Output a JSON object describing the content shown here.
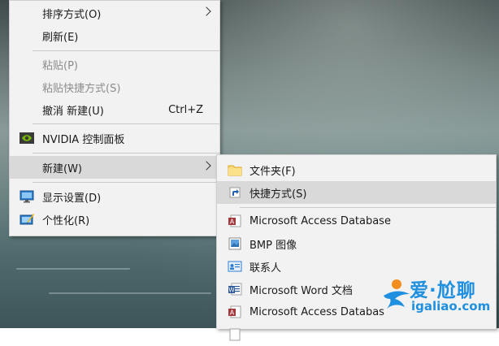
{
  "context_menu": {
    "items": [
      {
        "label": "排序方式(O)"
      },
      {
        "label": "刷新(E)"
      },
      {
        "label": "粘贴(P)"
      },
      {
        "label": "粘贴快捷方式(S)"
      },
      {
        "label": "撤消 新建(U)",
        "accel": "Ctrl+Z"
      },
      {
        "label": "NVIDIA 控制面板",
        "icon": "nvidia-icon"
      },
      {
        "label": "新建(W)"
      },
      {
        "label": "显示设置(D)",
        "icon": "display-settings-icon"
      },
      {
        "label": "个性化(R)",
        "icon": "personalize-icon"
      }
    ]
  },
  "new_submenu": {
    "items": [
      {
        "label": "文件夹(F)",
        "icon": "folder-icon"
      },
      {
        "label": "快捷方式(S)",
        "icon": "shortcut-icon"
      },
      {
        "label": "Microsoft Access Database",
        "icon": "access-icon"
      },
      {
        "label": "BMP 图像",
        "icon": "bmp-image-icon"
      },
      {
        "label": "联系人",
        "icon": "contact-icon"
      },
      {
        "label": "Microsoft Word 文档",
        "icon": "word-icon"
      },
      {
        "label": "Microsoft Access Databas",
        "icon": "access-icon"
      }
    ]
  },
  "watermark": {
    "text_main": "爱·尬聊",
    "text_url": "igaliao.com"
  },
  "colors": {
    "menu_bg": "#f2f2f2",
    "highlight": "#d9d9d9",
    "disabled_text": "#8c8c8c",
    "watermark_blue": "#1f8fe0"
  }
}
